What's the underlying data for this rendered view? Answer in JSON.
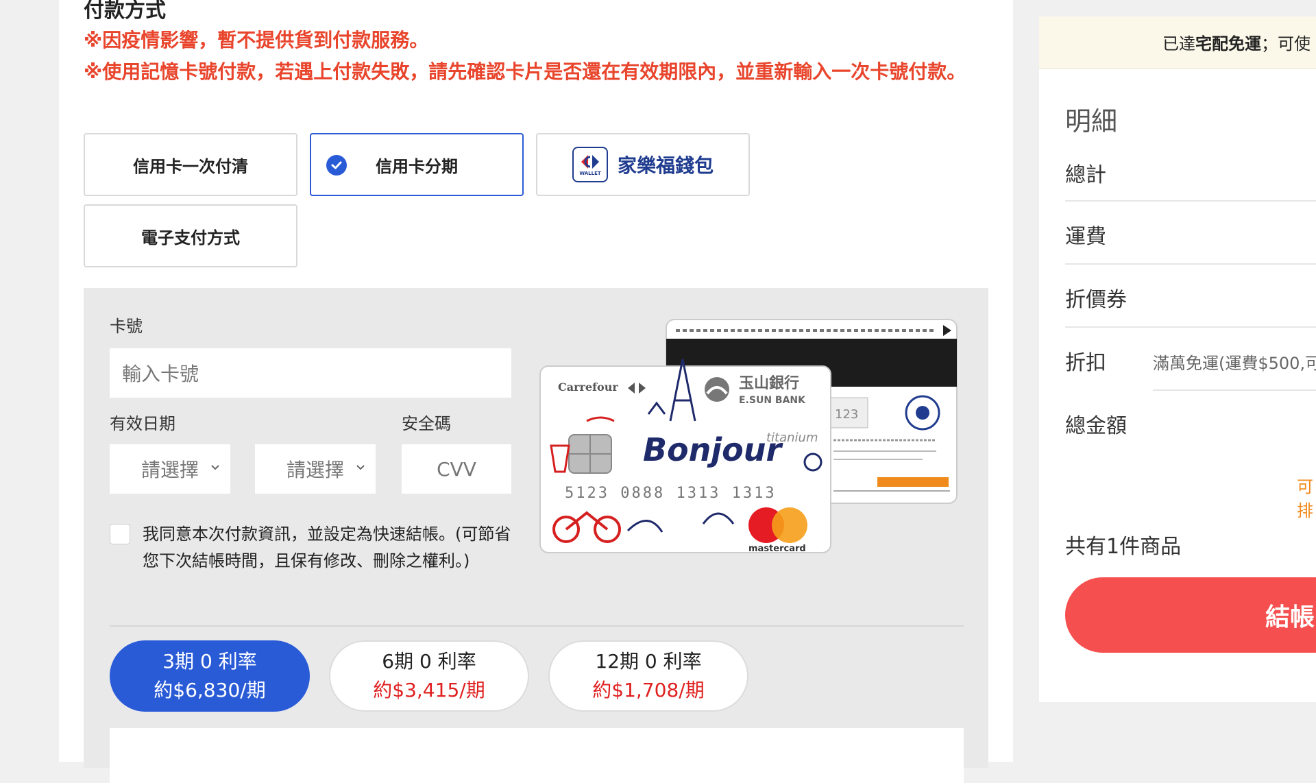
{
  "payment": {
    "section_title": "付款方式",
    "notices": [
      "※因疫情影響，暫不提供貨到付款服務。",
      "※使用記憶卡號付款，若遇上付款失敗，請先確認卡片是否還在有效期限內，並重新輸入一次卡號付款。"
    ],
    "methods": {
      "credit_once": "信用卡一次付清",
      "credit_installment": "信用卡分期",
      "wallet": "家樂福錢包",
      "wallet_logo_text": "WALLET",
      "epay": "電子支付方式"
    },
    "selected_method": "信用卡分期"
  },
  "card_form": {
    "card_number_label": "卡號",
    "card_number_placeholder": "輸入卡號",
    "expiry_label": "有效日期",
    "month_select": "請選擇",
    "year_select": "請選擇",
    "cvv_label": "安全碼",
    "cvv_placeholder": "CVV",
    "agree_text": "我同意本次付款資訊，並設定為快速結帳。(可節省您下次結帳時間，且保有修改、刪除之權利。)",
    "agree_checked": false
  },
  "card_image": {
    "brand": "Carrefour",
    "bank_cn": "玉山銀行",
    "bank_en": "E.SUN BANK",
    "tag": "Bonjour",
    "tier": "titanium",
    "number": "5123 0888 1313 1313",
    "network": "mastercard",
    "back_cvv": "123"
  },
  "installments": [
    {
      "plan": "3期 0 利率",
      "per": "約$6,830/期",
      "active": true
    },
    {
      "plan": "6期 0 利率",
      "per": "約$3,415/期",
      "active": false
    },
    {
      "plan": "12期 0 利率",
      "per": "約$1,708/期",
      "active": false
    }
  ],
  "summary": {
    "shipping_notice_prefix": "已達",
    "shipping_notice_bold": "宅配免運",
    "shipping_notice_suffix": "；可使",
    "title": "明細",
    "rows": [
      "總計",
      "運費",
      "折價券",
      "折扣",
      "總金額"
    ],
    "discount_detail": "滿萬免運(運費$500,可",
    "orange_hint": "可排",
    "item_count": "共有1件商品",
    "checkout_label": "結帳"
  },
  "colors": {
    "accent": "#2a5bd7",
    "notice_red": "#e8452c",
    "price_red": "#e02020",
    "checkout": "#f5504f",
    "orange": "#f08a1c"
  }
}
